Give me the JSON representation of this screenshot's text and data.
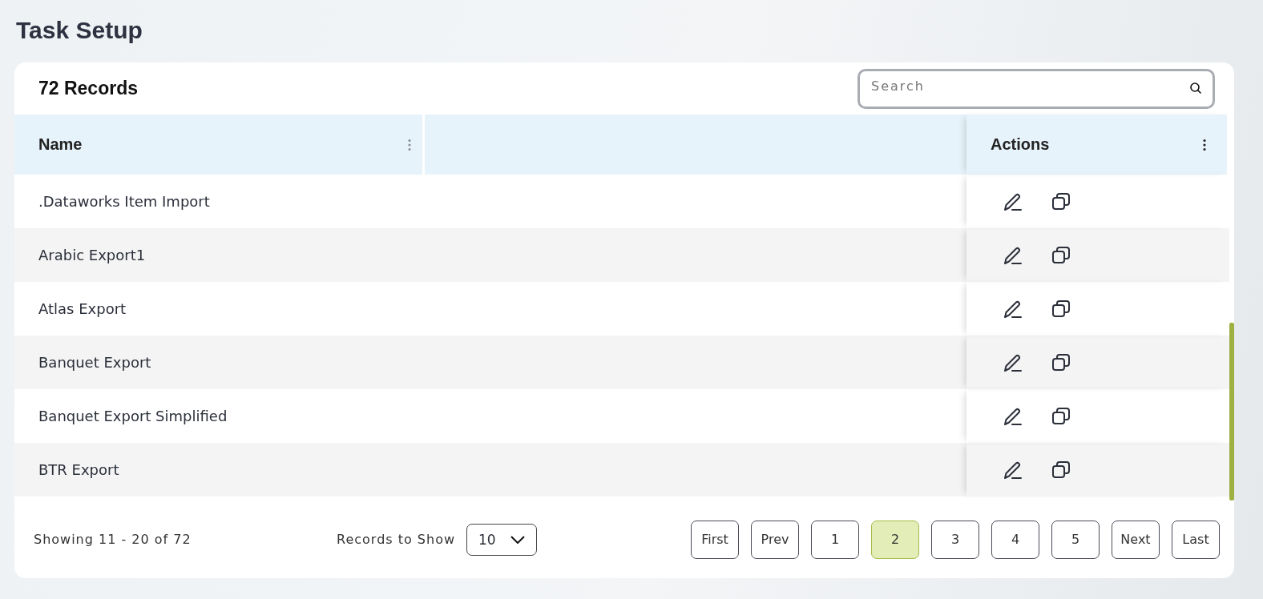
{
  "page_title": "Task Setup",
  "records_count": "72 Records",
  "search": {
    "placeholder": "Search"
  },
  "table": {
    "columns": [
      {
        "label": "Name"
      },
      {
        "label": "Actions"
      }
    ],
    "rows": [
      {
        "name": ".Dataworks Item Import"
      },
      {
        "name": "Arabic Export1"
      },
      {
        "name": "Atlas Export"
      },
      {
        "name": "Banquet Export"
      },
      {
        "name": "Banquet Export Simplified"
      },
      {
        "name": "BTR Export"
      }
    ]
  },
  "footer": {
    "showing": "Showing 11 - 20 of 72",
    "records_label": "Records to Show",
    "records_value": "10",
    "pages": [
      {
        "label": "First",
        "selected": false
      },
      {
        "label": "Prev",
        "selected": false
      },
      {
        "label": "1",
        "selected": false
      },
      {
        "label": "2",
        "selected": true
      },
      {
        "label": "3",
        "selected": false
      },
      {
        "label": "4",
        "selected": false
      },
      {
        "label": "5",
        "selected": false
      },
      {
        "label": "Next",
        "selected": false
      },
      {
        "label": "Last",
        "selected": false
      }
    ]
  }
}
